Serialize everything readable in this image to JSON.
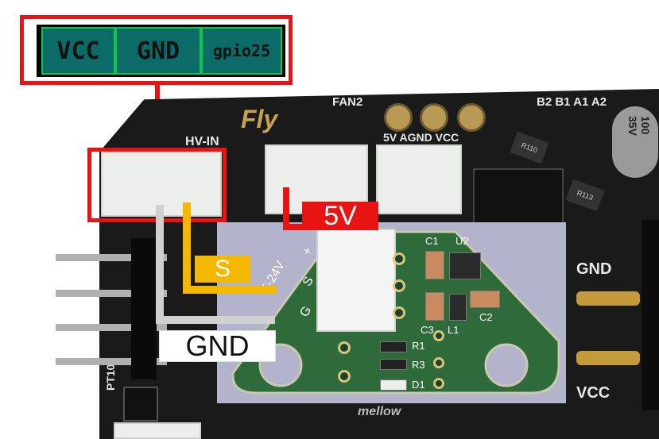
{
  "pin_header": {
    "pins": [
      "VCC",
      "GND",
      "gpio25"
    ]
  },
  "board": {
    "brand": "Fly",
    "connector_label": "HV-IN",
    "fan_label": "FAN2",
    "fan_pins": "5V AGND VCC",
    "motor_labels": "B2 B1 A1 A2",
    "side_gnd": "GND",
    "side_vcc": "VCC",
    "pt_label": "PT100",
    "cap_text": "100 35V",
    "chip1": "R110",
    "chip2": "R113",
    "bottom_text": "mellow"
  },
  "callouts": {
    "power": "5V",
    "signal": "S",
    "ground": "GND"
  },
  "sensor_pcb": {
    "header_labels": [
      "+",
      "S",
      "G"
    ],
    "voltage_label": "5-24V",
    "components": [
      "C1",
      "U2",
      "C2",
      "C3",
      "L1",
      "R1",
      "R3",
      "D1"
    ]
  },
  "colors": {
    "red": "#e81313",
    "yellow": "#f5b800",
    "gray": "#d0d0d0",
    "pcb_green": "#2f6b3a",
    "board_black": "#1a1a1a"
  }
}
